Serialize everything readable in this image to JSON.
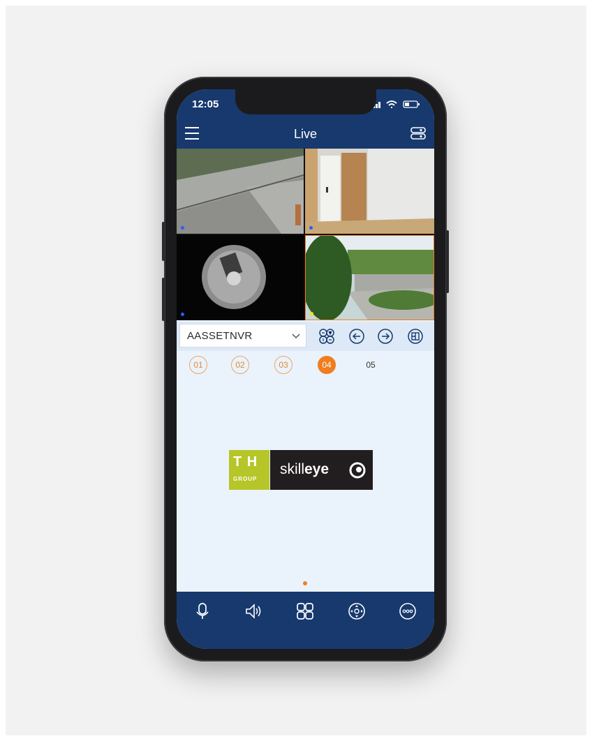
{
  "status_bar": {
    "time": "12:05"
  },
  "header": {
    "title": "Live"
  },
  "device_selector": {
    "value": "AASSETNVR"
  },
  "channels": [
    "01",
    "02",
    "03",
    "04",
    "05"
  ],
  "active_channel": "04",
  "brand": {
    "group_mark": "T H",
    "group_label": "GROUP",
    "product_prefix": "skill",
    "product_bold": "eye"
  },
  "colors": {
    "header_bg": "#17396d",
    "accent_orange": "#f07d1f",
    "content_bg": "#eaf3fb",
    "tkh_green": "#b6c528"
  },
  "icons": {
    "header_left": "menu-icon",
    "header_right": "device-list-icon",
    "controls": [
      "ptz-icon",
      "previous-icon",
      "next-icon",
      "split-screen-icon"
    ],
    "bottom_tabs": [
      "microphone-icon",
      "speaker-icon",
      "layout-grid-icon",
      "ptz-control-icon",
      "more-icon"
    ]
  }
}
